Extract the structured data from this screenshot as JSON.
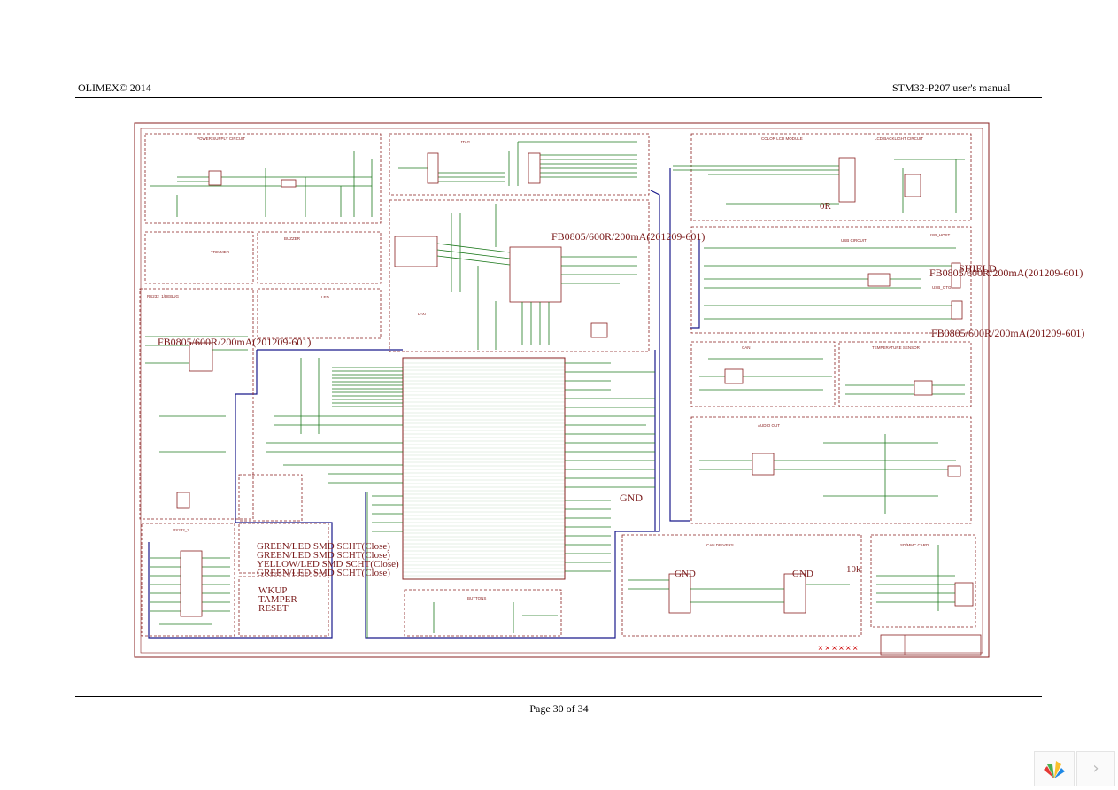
{
  "header": {
    "left": "OLIMEX© 2014",
    "right": "STM32-P207 user's manual"
  },
  "footer": {
    "page": "Page 30 of 34"
  },
  "schematic": {
    "blocks": [
      "POWER SUPPLY CIRCUIT",
      "JTAG",
      "COLOR LCD MODULE",
      "LCD BACKLIGHT CIRCUIT",
      "TRIMMER",
      "BUZZER",
      "RS232_1",
      "LAN",
      "USB CIRCUIT",
      "USB_HOST",
      "USB_OTG",
      "CAN",
      "TEMPERATURE SENSOR",
      "AUDIO OUT",
      "RS232_2",
      "BUTTONS",
      "SD/MMC CARD",
      "LEDS"
    ],
    "labels": {
      "fb_lcd": "FB0805/600R/200mA(201209-601)",
      "fb_usb1": "FB0805/600R/200mA(201209-601)",
      "fb_usb2": "FB0805/600R/200mA(201209-601)",
      "fb_left": "FB0805/600R/200mA(201209-601)",
      "shield": "SHIELD",
      "gnd_main": "GND",
      "gnd_can1": "GND",
      "gnd_can2": "GND",
      "r_0r": "0R",
      "r_10k": "10k",
      "led1": "GREEN/LED SMD SCHT(Close)",
      "led2": "GREEN/LED SMD SCHT(Close)",
      "led3": "YELLOW/LED SMD SCHT(Close)",
      "led4": "GREEN/LED SMD SCHT(Close)",
      "btn1": "WKUP",
      "btn2": "TAMPER",
      "btn3": "RESET",
      "frame_marks": "××××××"
    }
  },
  "viewer": {
    "next_icon": "chevron-right-icon",
    "next_glyph": "›",
    "logo_icon": "viewer-logo-icon"
  }
}
